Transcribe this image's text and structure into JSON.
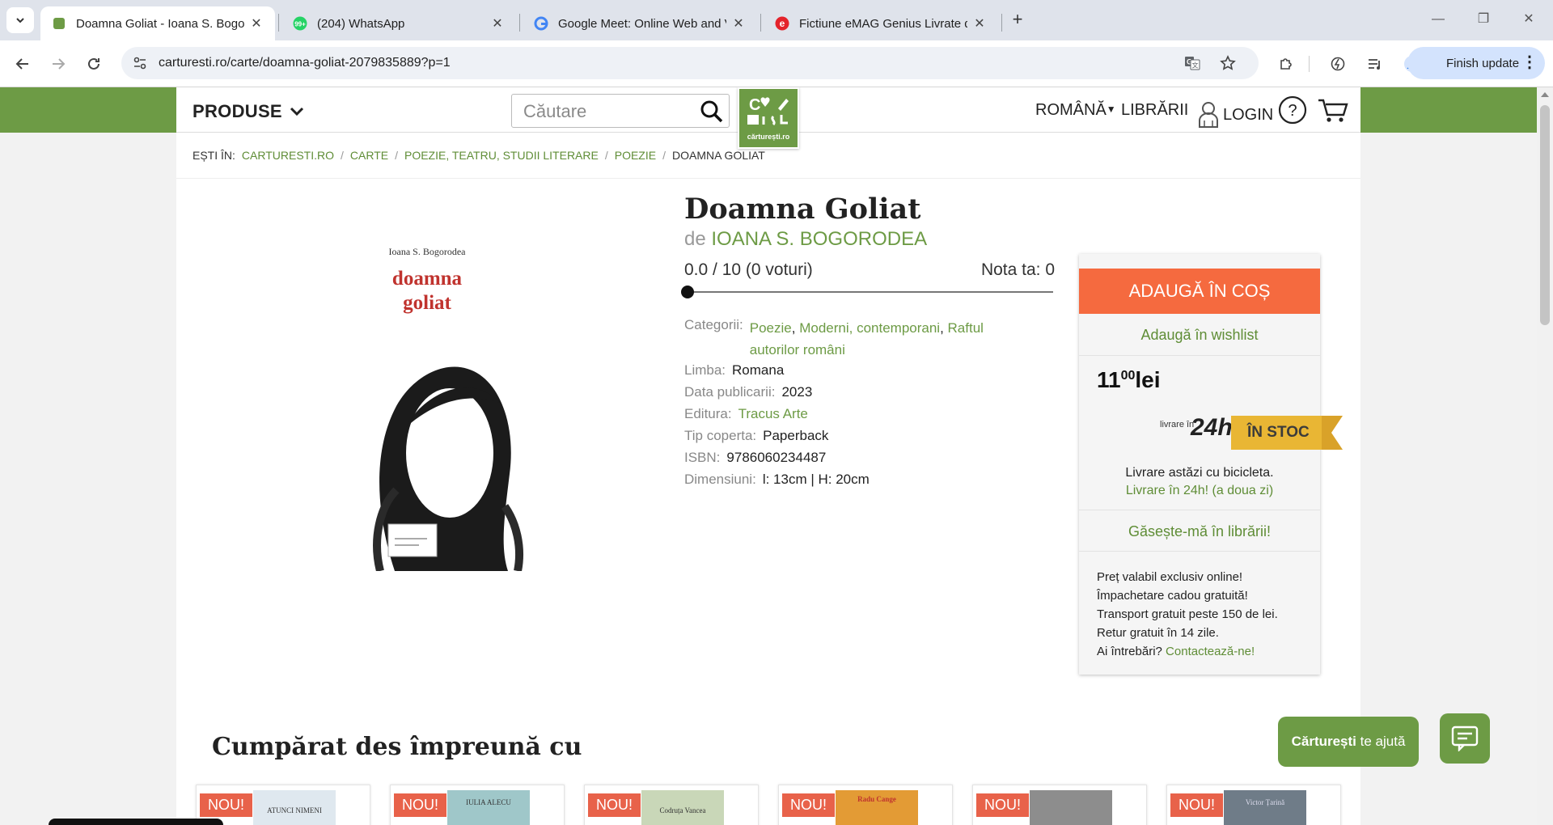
{
  "browser": {
    "tabs": [
      {
        "title": "Doamna Goliat - Ioana S. Bogorodea",
        "active": true
      },
      {
        "title": "(204) WhatsApp",
        "badge": "99+"
      },
      {
        "title": "Google Meet: Online Web and Video Calls"
      },
      {
        "title": "Fictiune eMAG Genius Livrate de eMAG"
      }
    ],
    "url": "carturesti.ro/carte/doamna-goliat-2079835889?p=1",
    "finish_update": "Finish update"
  },
  "site": {
    "menu_label": "PRODUSE",
    "search_placeholder": "Căutare",
    "logo_text": "cărturești.ro",
    "language": "ROMÂNĂ",
    "bookstores": "LIBRĂRII",
    "login": "LOGIN"
  },
  "breadcrumb": {
    "prefix": "EȘTI ÎN:",
    "items": [
      "CARTURESTI.RO",
      "CARTE",
      "POEZIE, TEATRU, STUDII LITERARE",
      "POEZIE",
      "DOAMNA GOLIAT"
    ]
  },
  "product": {
    "cover_author": "Ioana S. Bogorodea",
    "cover_title_1": "doamna",
    "cover_title_2": "goliat",
    "title": "Doamna Goliat",
    "by": "de",
    "author": "IOANA S. BOGORODEA",
    "rating": "0.0 / 10 (0 voturi)",
    "your_rating": "Nota ta: 0",
    "your_rating_value": 0,
    "categories_label": "Categorii:",
    "categories": [
      "Poezie",
      "Moderni, contemporani",
      "Raftul",
      "autorilor români"
    ],
    "language_label": "Limba:",
    "language_value": "Romana",
    "date_label": "Data publicarii:",
    "date_value": "2023",
    "publisher_label": "Editura:",
    "publisher_value": "Tracus Arte",
    "cover_type_label": "Tip coperta:",
    "cover_type_value": "Paperback",
    "isbn_label": "ISBN:",
    "isbn_value": "9786060234487",
    "dims_label": "Dimensiuni:",
    "dims_value": "l: 13cm | H: 20cm"
  },
  "buybox": {
    "add_to_cart": "ADAUGĂ ÎN COȘ",
    "wishlist": "Adaugă în wishlist",
    "price_int": "11",
    "price_dec": "00",
    "currency": "lei",
    "delivery_small": "livrare în",
    "delivery_24h": "24h",
    "stock": "ÎN STOC",
    "delivery_line1": "Livrare astăzi cu bicicleta.",
    "delivery_line2": "Livrare în 24h! (a doua zi)",
    "find_in_store": "Găsește-mă în librării!",
    "perks": [
      "Preț valabil exclusiv online!",
      "Împachetare cadou gratuită!",
      "Transport gratuit peste 150 de lei.",
      "Retur gratuit în 14 zile."
    ],
    "question": "Ai întrebări?",
    "contact": "Contactează-ne!"
  },
  "related": {
    "title": "Cumpărat des împreună cu",
    "badge": "NOU!",
    "cards": [
      {
        "cover_text": "ATUNCI NIMENI",
        "color": "#dfe8ef"
      },
      {
        "cover_text": "IULIA ALECU",
        "color": "#9fc7c9"
      },
      {
        "cover_text": "Codruța Vancea",
        "color": "#c9d7b8"
      },
      {
        "cover_text": "Radu Cange",
        "color": "#e39b35"
      },
      {
        "cover_text": "",
        "color": "#8d8d8d"
      },
      {
        "cover_text": "Victor Țarină",
        "color": "#6f7c88"
      }
    ]
  },
  "help_widget": {
    "brand": "Cărturești",
    "text": "te ajută"
  },
  "colors": {
    "brand_green": "#6d9b45",
    "cta_orange": "#f56a3f",
    "stock_gold": "#e9b634"
  }
}
